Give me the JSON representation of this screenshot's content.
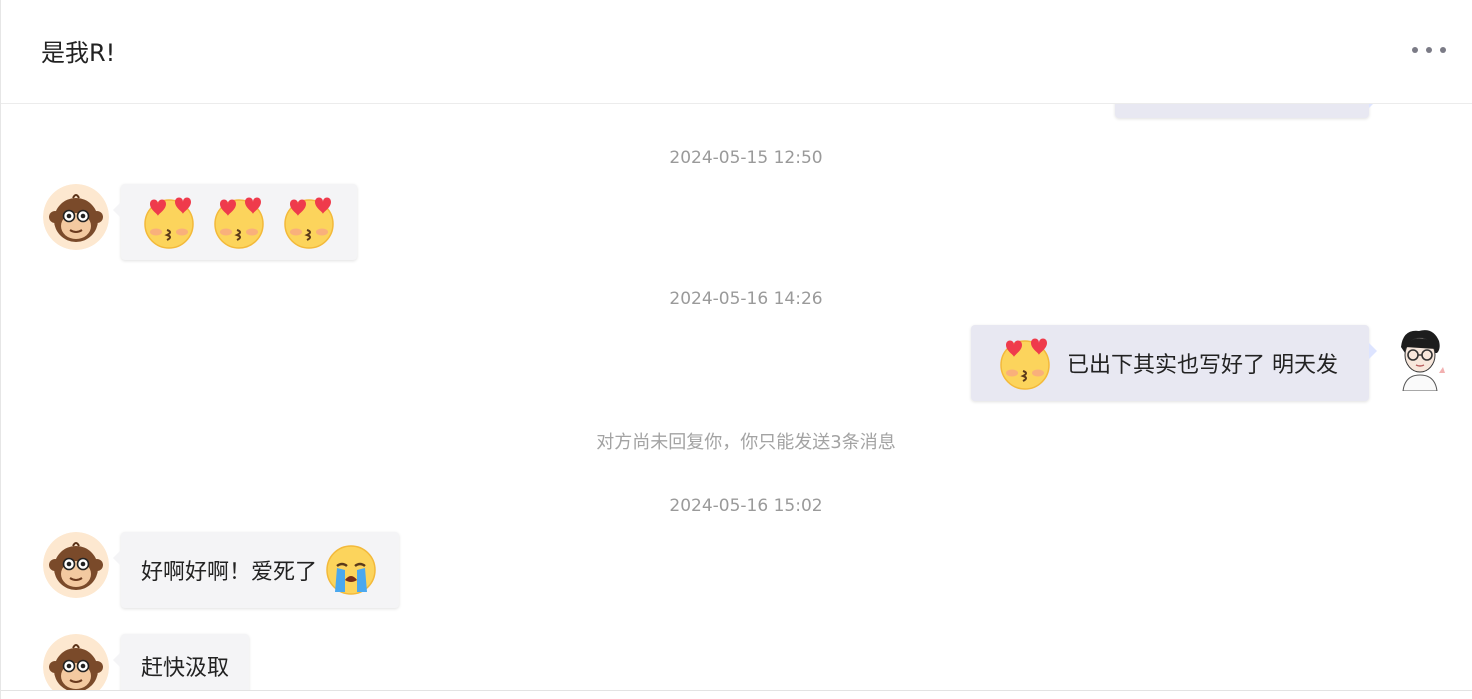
{
  "header": {
    "title": "是我R!",
    "more_icon": "more-horizontal-icon"
  },
  "messages": [
    {
      "type": "timestamp",
      "text": "2024-05-15 12:50"
    },
    {
      "type": "message",
      "side": "left",
      "emojis": [
        "heart-eyes-kiss",
        "heart-eyes-kiss",
        "heart-eyes-kiss"
      ]
    },
    {
      "type": "timestamp",
      "text": "2024-05-16 14:26"
    },
    {
      "type": "message",
      "side": "right",
      "emoji": "heart-eyes-kiss",
      "text": "已出下其实也写好了 明天发"
    },
    {
      "type": "system",
      "text": "对方尚未回复你，你只能发送3条消息"
    },
    {
      "type": "timestamp",
      "text": "2024-05-16 15:02"
    },
    {
      "type": "message",
      "side": "left",
      "text": "好啊好啊！爱死了",
      "emoji": "crying"
    },
    {
      "type": "message",
      "side": "left",
      "text": "赶快汲取"
    }
  ],
  "colors": {
    "left_bubble": "#f4f4f6",
    "right_bubble": "#e8e8f2",
    "timestamp_text": "#9a9a9a"
  }
}
